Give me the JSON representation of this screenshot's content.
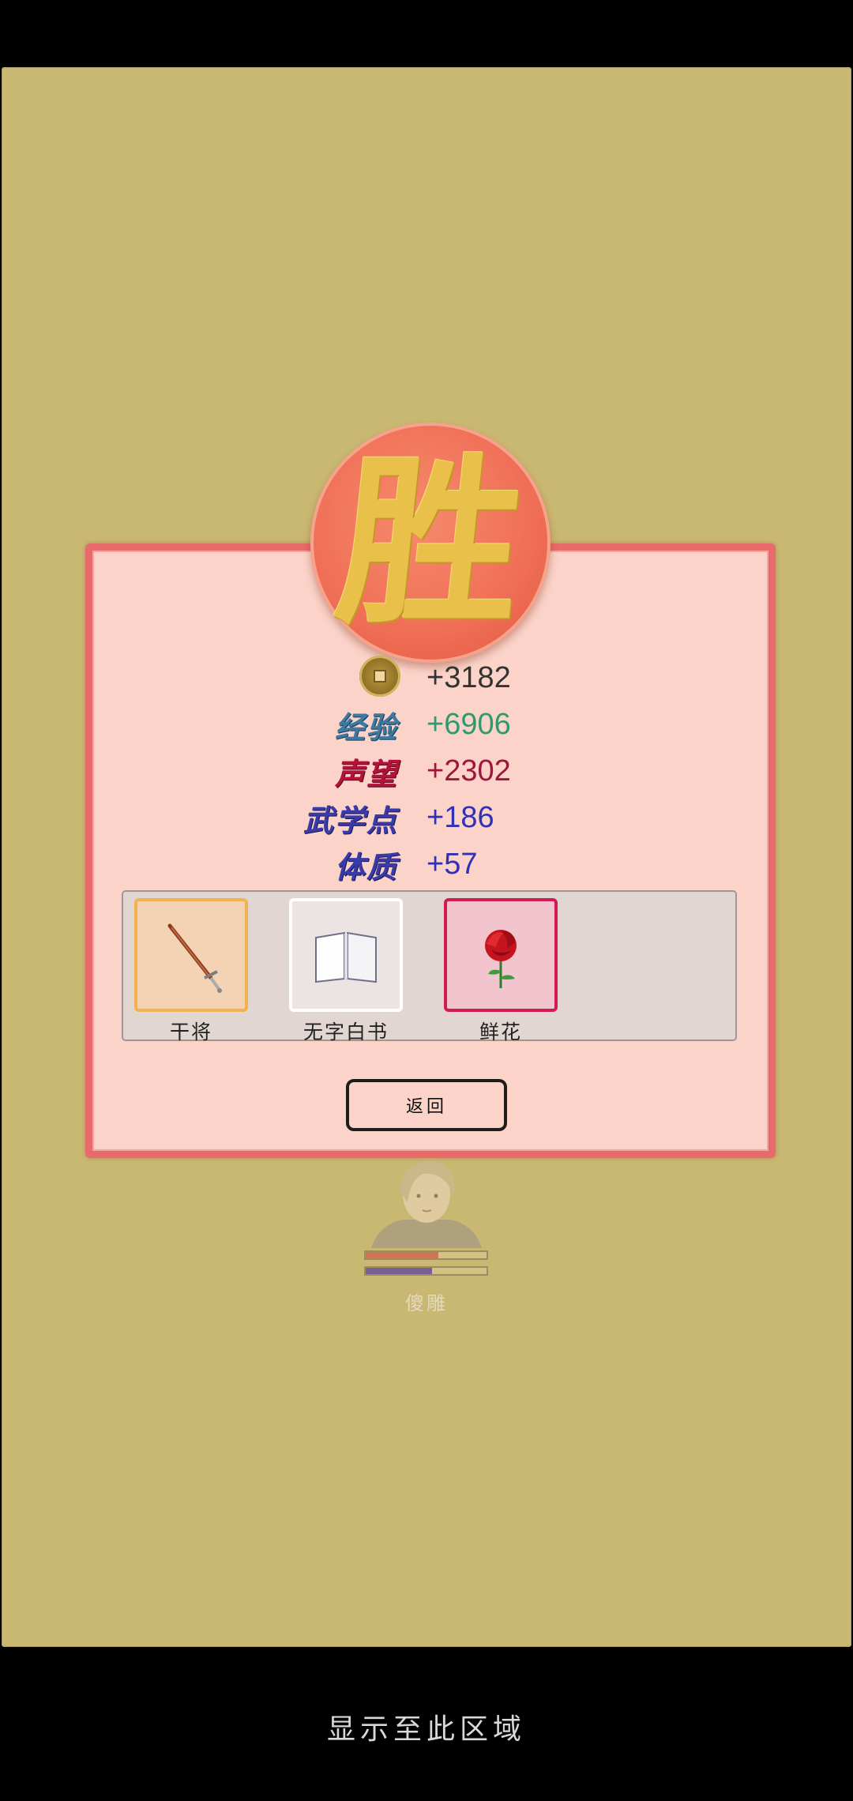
{
  "win_seal": {
    "glyph": "胜"
  },
  "rewards": [
    {
      "label": "",
      "value": "+3182",
      "color": "#333333",
      "icon": "coin-icon"
    },
    {
      "label": "经验",
      "value": "+6906",
      "color": "#2f9a6f",
      "label_color": "#3e7aa0"
    },
    {
      "label": "声望",
      "value": "+2302",
      "color": "#a0163b",
      "label_color": "#b3123a"
    },
    {
      "label": "武学点",
      "value": "+186",
      "color": "#3131b6",
      "label_color": "#3a3aa8"
    },
    {
      "label": "体质",
      "value": "+57",
      "color": "#3131b6",
      "label_color": "#3a3aa8"
    }
  ],
  "items": [
    {
      "name": "干将",
      "icon": "sword-icon",
      "border": "#f2b24f",
      "bg": "#f3d3b4"
    },
    {
      "name": "无字白书",
      "icon": "book-icon",
      "border": "#ffffff",
      "bg": "#ece4e2"
    },
    {
      "name": "鲜花",
      "icon": "rose-icon",
      "border": "#d41a55",
      "bg": "#f2c4cd"
    }
  ],
  "back_button": {
    "label": "返回"
  },
  "character": {
    "name": "傻雕",
    "hp_fraction": 0.6,
    "mp_fraction": 0.55
  },
  "footer": {
    "text": "显示至此区域"
  }
}
